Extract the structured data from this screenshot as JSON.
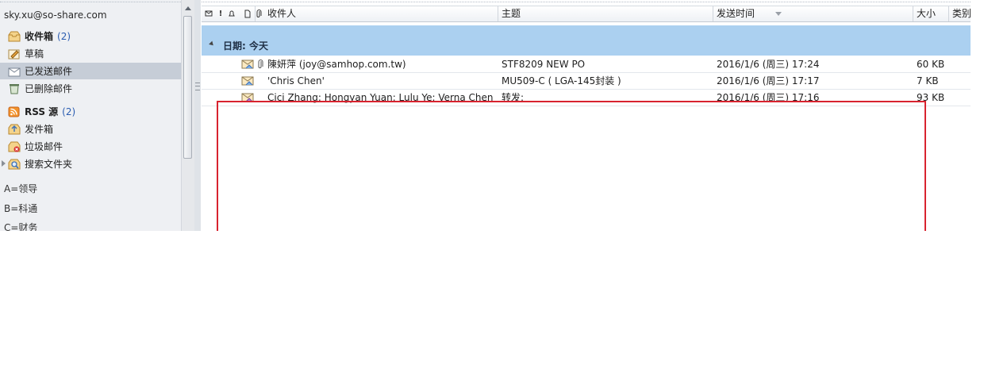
{
  "navigation": {
    "account": "sky.xu@so-share.com",
    "folders": [
      {
        "label": "收件箱",
        "count": "(2)",
        "bold": true,
        "icon": "inbox-icon"
      },
      {
        "label": "草稿",
        "count": "",
        "bold": false,
        "icon": "drafts-icon"
      },
      {
        "label": "已发送邮件",
        "count": "",
        "bold": false,
        "icon": "sent-items-icon",
        "selected": true
      },
      {
        "label": "已删除邮件",
        "count": "",
        "bold": false,
        "icon": "deleted-items-icon"
      },
      {
        "label": "RSS 源",
        "count": "(2)",
        "bold": true,
        "icon": "rss-icon"
      },
      {
        "label": "发件箱",
        "count": "",
        "bold": false,
        "icon": "outbox-icon"
      },
      {
        "label": "垃圾邮件",
        "count": "",
        "bold": false,
        "icon": "junk-icon"
      },
      {
        "label": "搜索文件夹",
        "count": "",
        "bold": false,
        "icon": "search-folder-icon"
      }
    ],
    "categories": [
      "A=领导",
      "B=科通",
      "C=财务"
    ]
  },
  "list": {
    "columns": {
      "to": "收件人",
      "subject": "主题",
      "sent": "发送时间",
      "size": "大小",
      "category": "类别"
    },
    "group_label": "日期: 今天",
    "rows": [
      {
        "to": "陳妍萍 (joy@samhop.com.tw)",
        "subject": "STF8209    NEW PO",
        "sent": "2016/1/6 (周三) 17:24",
        "size": "60 KB",
        "attachment": true
      },
      {
        "to": "'Chris Chen'",
        "subject": "MU509-C ( LGA-145封装 )",
        "sent": "2016/1/6 (周三) 17:17",
        "size": "7 KB",
        "attachment": false
      },
      {
        "to": "Cici Zhang; Hongyan Yuan; Lulu Ye; Verna Chen",
        "subject": "转发:",
        "sent": "2016/1/6 (周三) 17:16",
        "size": "93 KB",
        "attachment": false
      }
    ]
  },
  "colors": {
    "selection": "#c6cdd7",
    "group_band": "#abd0f0",
    "count_blue": "#2a5cb0",
    "annotation_red": "#d8232f"
  }
}
